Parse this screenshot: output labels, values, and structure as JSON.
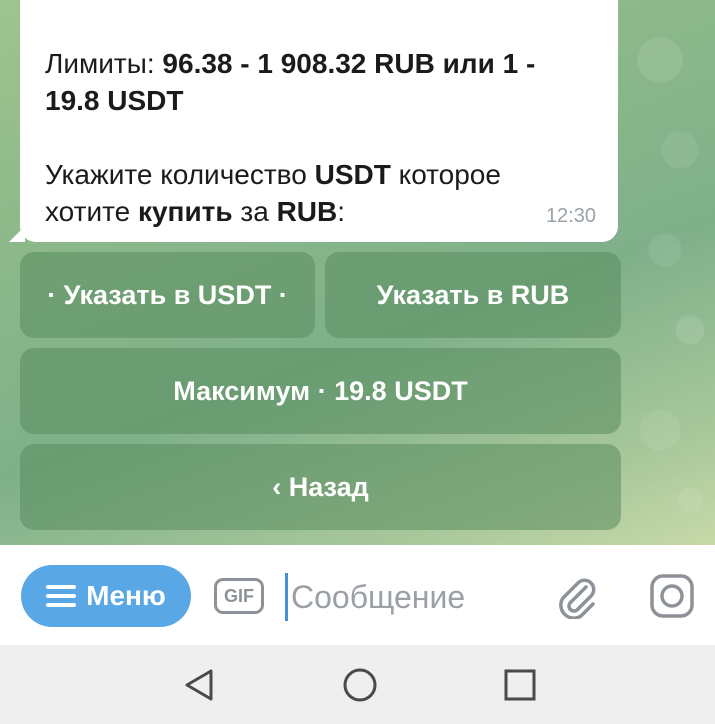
{
  "message": {
    "limits_prefix": "Лимиты: ",
    "limits_value": "96.38 - 1 908.32 RUB",
    "limits_or": " или ",
    "limits_usdt": "1 - 19.8 USDT",
    "prompt_part1": "Укажите количество ",
    "prompt_usdt": "USDT",
    "prompt_part2": " которое хотите ",
    "prompt_buy": "купить",
    "prompt_part3": " за ",
    "prompt_rub": "RUB",
    "prompt_end": ":",
    "time": "12:30"
  },
  "keyboard": {
    "usdt_label": "· Указать в USDT ·",
    "rub_label": "Указать в RUB",
    "max_label": "Максимум · 19.8 USDT",
    "back_label": "‹ Назад"
  },
  "input_bar": {
    "menu_label": "Меню",
    "gif_label": "GIF",
    "placeholder": "Сообщение"
  },
  "icons": {
    "menu": "hamburger-icon",
    "gif": "gif-icon",
    "attach": "paperclip-icon",
    "camera": "camera-icon",
    "back": "triangle-back-icon",
    "home": "circle-home-icon",
    "recents": "square-recents-icon"
  },
  "colors": {
    "menu_button": "#5aa7e5",
    "keyboard_button": "#5a8c5f",
    "caret": "#4a90d9"
  }
}
